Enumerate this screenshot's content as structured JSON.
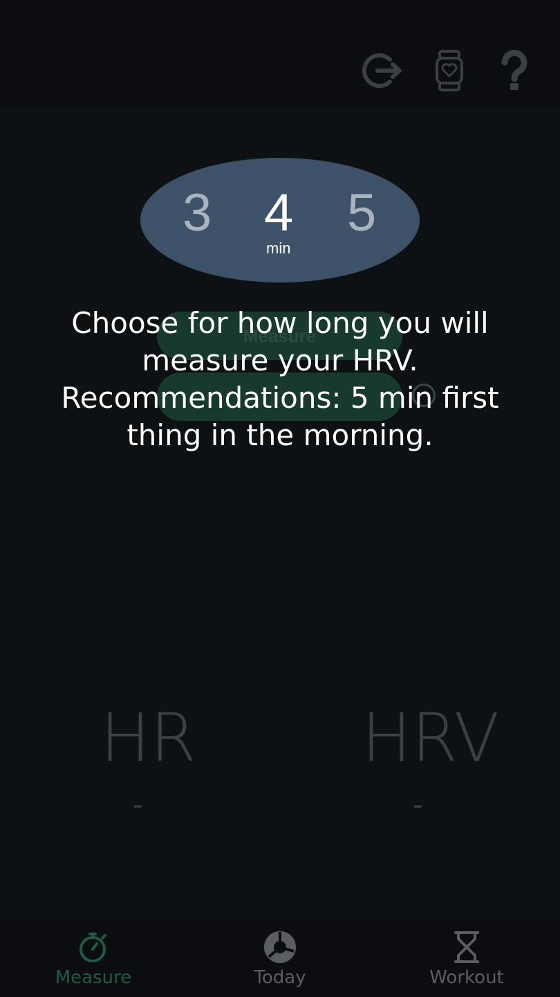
{
  "header": {
    "icons": [
      "logout-icon",
      "watch-heart-icon",
      "help-icon"
    ]
  },
  "picker": {
    "options": [
      "3",
      "4",
      "5"
    ],
    "selected": "4",
    "unit": "min"
  },
  "buttons": {
    "measure_label": "Measure"
  },
  "overlay": {
    "line1": "Choose for how long you will",
    "line2": "measure your HRV.",
    "line3": "Recommendations: 5 min first",
    "line4": "thing in the morning."
  },
  "stats": {
    "hr_label": "HR",
    "hr_value": "-",
    "hrv_label": "HRV",
    "hrv_value": "-"
  },
  "nav": {
    "items": [
      {
        "label": "Measure",
        "icon": "stopwatch-icon",
        "active": true
      },
      {
        "label": "Today",
        "icon": "donut-chart-icon",
        "active": false
      },
      {
        "label": "Workout",
        "icon": "hourglass-icon",
        "active": false
      }
    ]
  },
  "colors": {
    "background": "#0e1114",
    "picker": "#3d5169",
    "accent_green": "#1f5a44",
    "inactive": "#5a5e63"
  }
}
